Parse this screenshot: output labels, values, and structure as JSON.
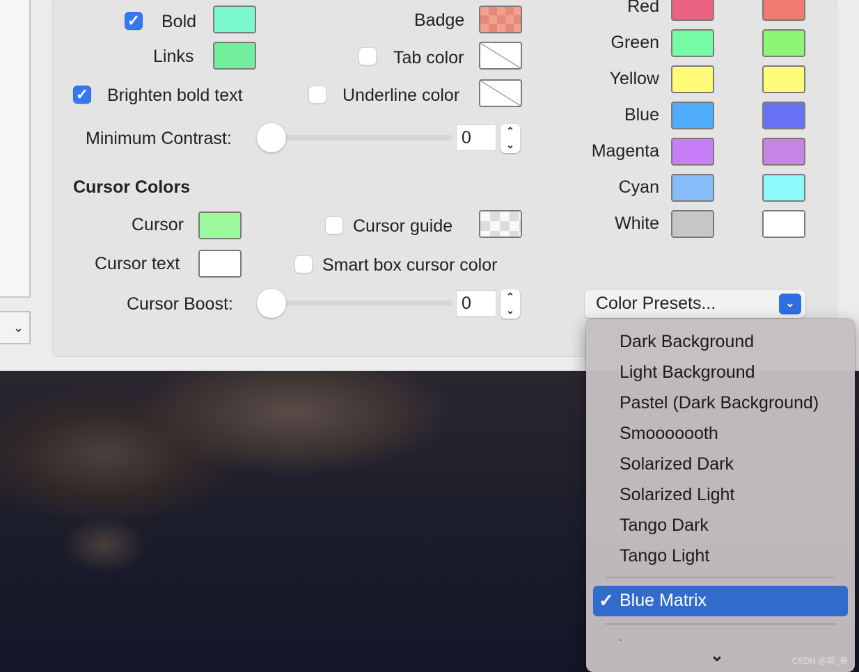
{
  "text_colors": {
    "bold": {
      "label": "Bold",
      "checked": true,
      "color": "#7cf9d0"
    },
    "links": {
      "label": "Links",
      "color": "#72ef9c"
    },
    "brighten": {
      "label": "Brighten bold text",
      "checked": true
    },
    "badge": {
      "label": "Badge",
      "color": "#f09a8a"
    },
    "tab_color": {
      "label": "Tab color",
      "checked": false
    },
    "underline_color": {
      "label": "Underline color",
      "checked": false
    },
    "min_contrast": {
      "label": "Minimum Contrast:",
      "value": "0",
      "level": 0
    }
  },
  "cursor": {
    "heading": "Cursor Colors",
    "cursor": {
      "label": "Cursor",
      "color": "#9bf99f"
    },
    "cursor_text": {
      "label": "Cursor text",
      "color": "#ffffff"
    },
    "cursor_guide": {
      "label": "Cursor guide",
      "checked": false
    },
    "smart_box": {
      "label": "Smart box cursor color",
      "checked": false
    },
    "boost": {
      "label": "Cursor Boost:",
      "value": "0",
      "level": 0
    }
  },
  "ansi": [
    {
      "label": "Red",
      "normal": "#ec6382",
      "bright": "#ef7a6d"
    },
    {
      "label": "Green",
      "normal": "#76fba4",
      "bright": "#8df673"
    },
    {
      "label": "Yellow",
      "normal": "#fffb77",
      "bright": "#fffb7b"
    },
    {
      "label": "Blue",
      "normal": "#4eacfb",
      "bright": "#6972f4"
    },
    {
      "label": "Magenta",
      "normal": "#c87ef8",
      "bright": "#c884e4"
    },
    {
      "label": "Cyan",
      "normal": "#86bdf8",
      "bright": "#8cf9fb"
    },
    {
      "label": "White",
      "normal": "#c6c6c6",
      "bright": "#ffffff"
    }
  ],
  "presets": {
    "button_label": "Color Presets...",
    "items": [
      "Dark Background",
      "Light Background",
      "Pastel (Dark Background)",
      "Smooooooth",
      "Solarized Dark",
      "Solarized Light",
      "Tango Dark",
      "Tango Light"
    ],
    "selected": "Blue Matrix",
    "check": "✓",
    "partial_item": "-"
  },
  "watermark": "CSDN @郭_昊"
}
